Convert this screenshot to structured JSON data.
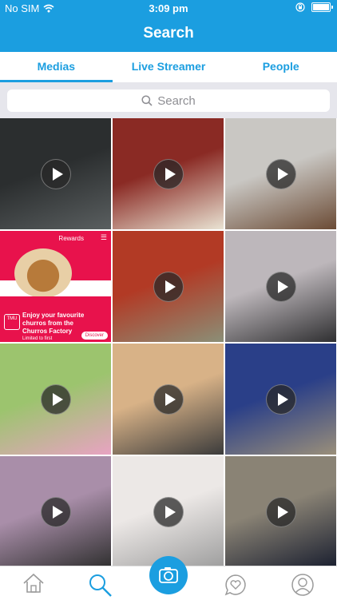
{
  "status_bar": {
    "carrier": "No SIM",
    "time": "3:09 pm",
    "battery_level": 0.92
  },
  "header": {
    "title": "Search"
  },
  "tabs": [
    {
      "label": "Medias",
      "active": true
    },
    {
      "label": "Live Streamer",
      "active": false
    },
    {
      "label": "People",
      "active": false
    }
  ],
  "search": {
    "placeholder": "Search"
  },
  "ad": {
    "rewards_label": "Rewards",
    "logo_text": "TMU",
    "headline": "Enjoy your favourite churros from the Churros Factory",
    "subtext": "Limited to first",
    "cta": "Discover"
  },
  "grid": {
    "tiles": [
      {
        "kind": "video",
        "scene": "dark floor",
        "colors": [
          "#2b2e2f",
          "#5a5f60"
        ]
      },
      {
        "kind": "video",
        "scene": "plates on red table",
        "colors": [
          "#8a2a24",
          "#e9e3d3"
        ]
      },
      {
        "kind": "video",
        "scene": "wall corner",
        "colors": [
          "#c9c7c3",
          "#6b4b35"
        ]
      },
      {
        "kind": "ad"
      },
      {
        "kind": "video",
        "scene": "soup and salad",
        "colors": [
          "#b23a25",
          "#8b8f77"
        ]
      },
      {
        "kind": "video",
        "scene": "water bottle",
        "colors": [
          "#bdb7bb",
          "#2f2f31"
        ]
      },
      {
        "kind": "video",
        "scene": "butterfly",
        "colors": [
          "#9cc46e",
          "#e8a3c2"
        ]
      },
      {
        "kind": "video",
        "scene": "wooden table",
        "colors": [
          "#d8b287",
          "#3b3b3b"
        ]
      },
      {
        "kind": "video",
        "scene": "exhibition hall",
        "colors": [
          "#2a3f88",
          "#9a8f7a"
        ]
      },
      {
        "kind": "video",
        "scene": "office desk",
        "colors": [
          "#a98ea9",
          "#303030"
        ]
      },
      {
        "kind": "video",
        "scene": "door",
        "colors": [
          "#ece8e6",
          "#9e9e9e"
        ]
      },
      {
        "kind": "video",
        "scene": "screen and ceiling",
        "colors": [
          "#8a8375",
          "#1b2030"
        ]
      }
    ]
  },
  "bottom_nav": {
    "items": [
      {
        "icon": "home-icon"
      },
      {
        "icon": "search-icon",
        "active": true
      },
      {
        "icon": "camera-icon"
      },
      {
        "icon": "heart-bubble-icon"
      },
      {
        "icon": "profile-icon"
      }
    ]
  },
  "colors": {
    "accent": "#1b9ee0",
    "ad_red": "#e8124c"
  }
}
